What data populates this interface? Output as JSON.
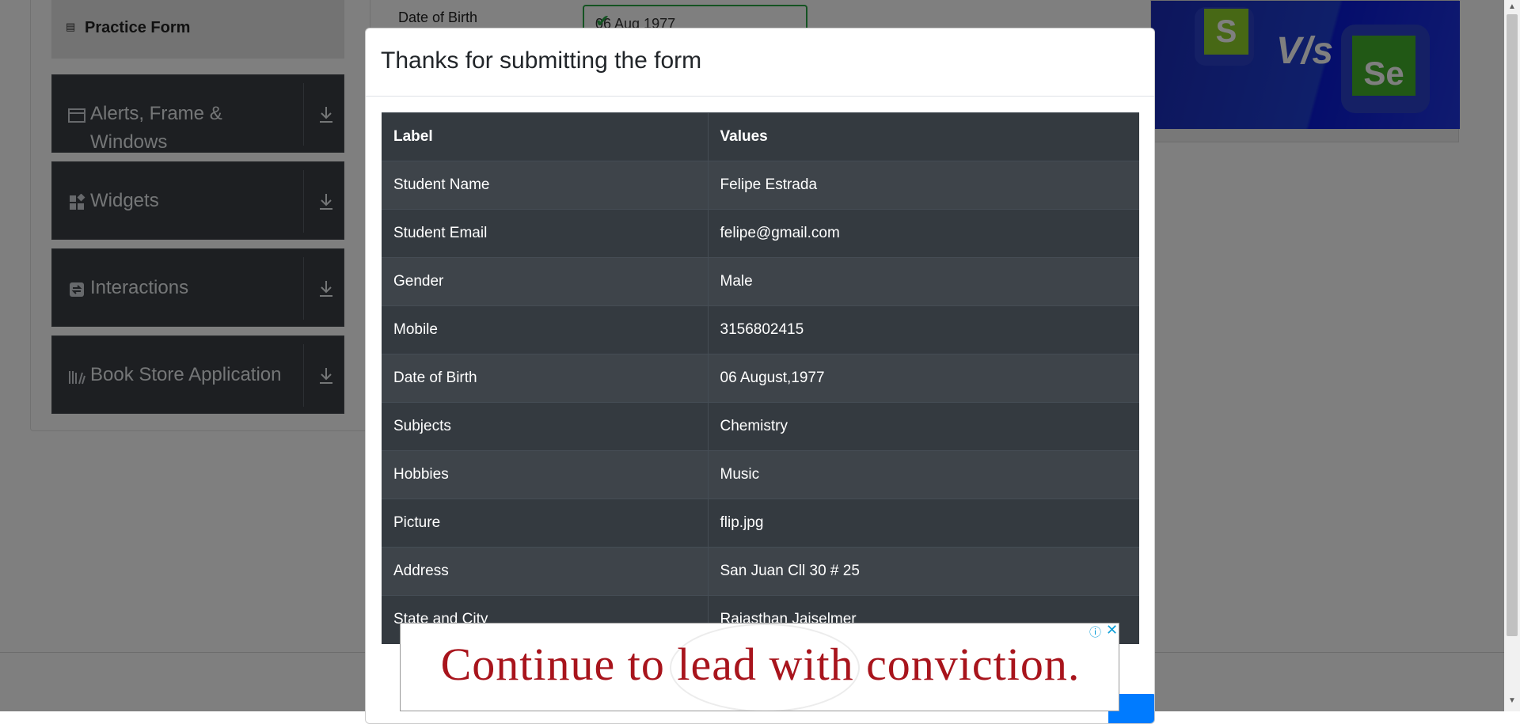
{
  "sidebar": {
    "active_item": "Practice Form",
    "groups": [
      {
        "label": "Alerts, Frame & Windows",
        "icon": "window-icon"
      },
      {
        "label": "Widgets",
        "icon": "widgets-icon"
      },
      {
        "label": "Interactions",
        "icon": "interactions-icon"
      },
      {
        "label": "Book Store Application",
        "icon": "books-icon"
      }
    ]
  },
  "form": {
    "dob_label": "Date of Birth",
    "dob_value": "06 Aug 1977"
  },
  "ad_image": {
    "left_logo": "S",
    "vs": "V/s",
    "right_logo": "Se"
  },
  "modal": {
    "title": "Thanks for submitting the form",
    "headers": [
      "Label",
      "Values"
    ],
    "rows": [
      [
        "Student Name",
        "Felipe Estrada"
      ],
      [
        "Student Email",
        "felipe@gmail.com"
      ],
      [
        "Gender",
        "Male"
      ],
      [
        "Mobile",
        "3156802415"
      ],
      [
        "Date of Birth",
        "06 August,1977"
      ],
      [
        "Subjects",
        "Chemistry"
      ],
      [
        "Hobbies",
        "Music"
      ],
      [
        "Picture",
        "flip.jpg"
      ],
      [
        "Address",
        "San Juan Cll 30 # 25"
      ],
      [
        "State and City",
        "Rajasthan Jaiselmer"
      ]
    ]
  },
  "bottom_ad": {
    "slogan": "Continue to lead with conviction."
  },
  "colors": {
    "modal_table_bg": "#343a40",
    "ad_red": "#a8141c",
    "accent": "#007bff",
    "valid_green": "#28a745"
  }
}
